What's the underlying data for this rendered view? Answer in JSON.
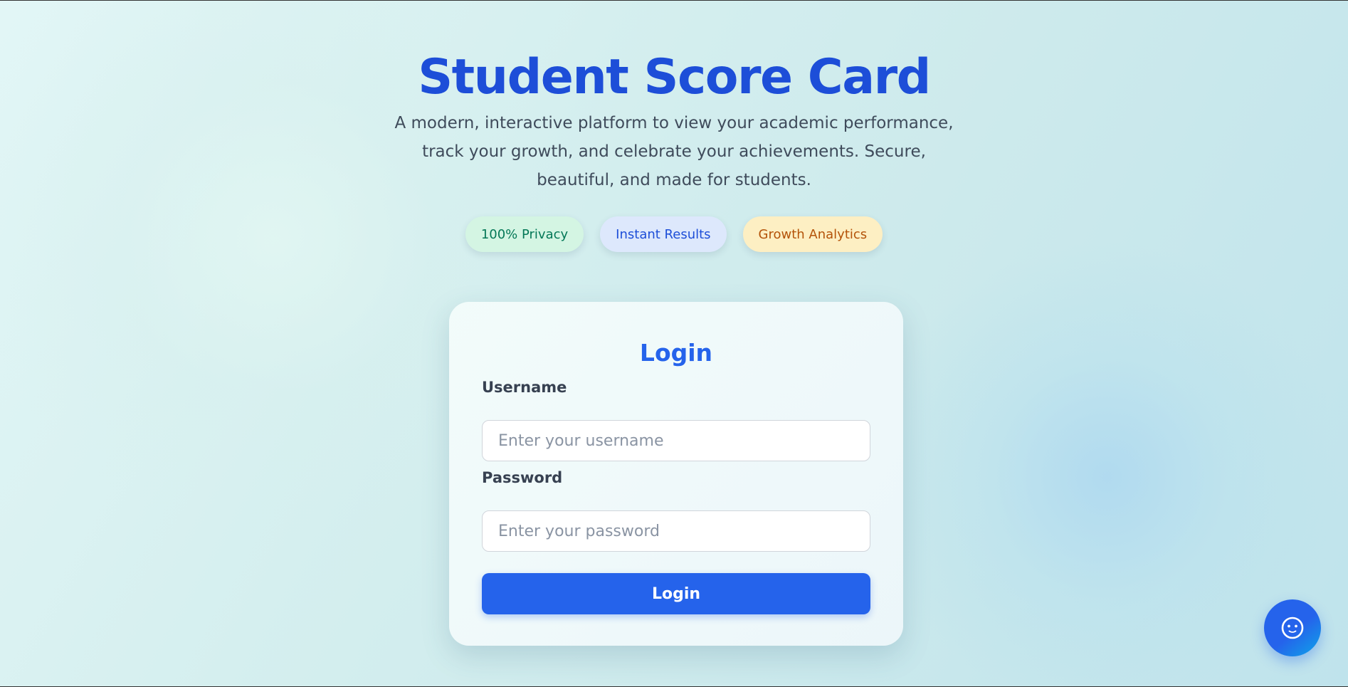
{
  "hero": {
    "title": "Student Score Card",
    "description": "A modern, interactive platform to view your academic performance, track your growth, and celebrate your achievements. Secure, beautiful, and made for students."
  },
  "badges": [
    {
      "label": "100% Privacy",
      "color": "#047857",
      "background": "#d4f5e3"
    },
    {
      "label": "Instant Results",
      "color": "#1d4ed8",
      "background": "#dde8fc"
    },
    {
      "label": "Growth Analytics",
      "color": "#b45309",
      "background": "#fdefc3"
    }
  ],
  "login": {
    "title": "Login",
    "username_label": "Username",
    "username_placeholder": "Enter your username",
    "username_value": "",
    "password_label": "Password",
    "password_placeholder": "Enter your password",
    "password_value": "",
    "submit_label": "Login"
  },
  "chat_button": {
    "icon": "chat-bot-icon"
  },
  "colors": {
    "accent": "#2563eb",
    "title": "#1d4ed8"
  }
}
